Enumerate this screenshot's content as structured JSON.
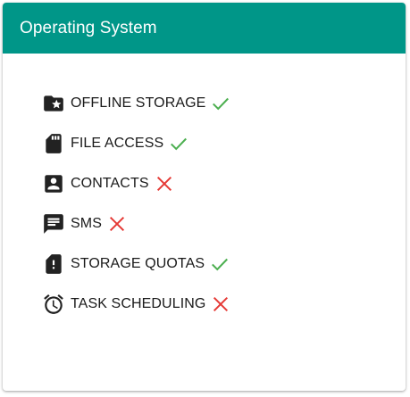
{
  "card": {
    "title": "Operating System"
  },
  "colors": {
    "header_bg": "#009688",
    "supported": "#4caf50",
    "unsupported": "#e53935",
    "icon": "#222222"
  },
  "features": [
    {
      "label": "OFFLINE STORAGE",
      "icon": "star-folder-icon",
      "status": "supported"
    },
    {
      "label": "FILE ACCESS",
      "icon": "sd-card-icon",
      "status": "supported"
    },
    {
      "label": "CONTACTS",
      "icon": "contact-icon",
      "status": "unsupported"
    },
    {
      "label": "SMS",
      "icon": "message-icon",
      "status": "unsupported"
    },
    {
      "label": "STORAGE QUOTAS",
      "icon": "sd-card-alert-icon",
      "status": "supported"
    },
    {
      "label": "TASK SCHEDULING",
      "icon": "alarm-icon",
      "status": "unsupported"
    }
  ]
}
